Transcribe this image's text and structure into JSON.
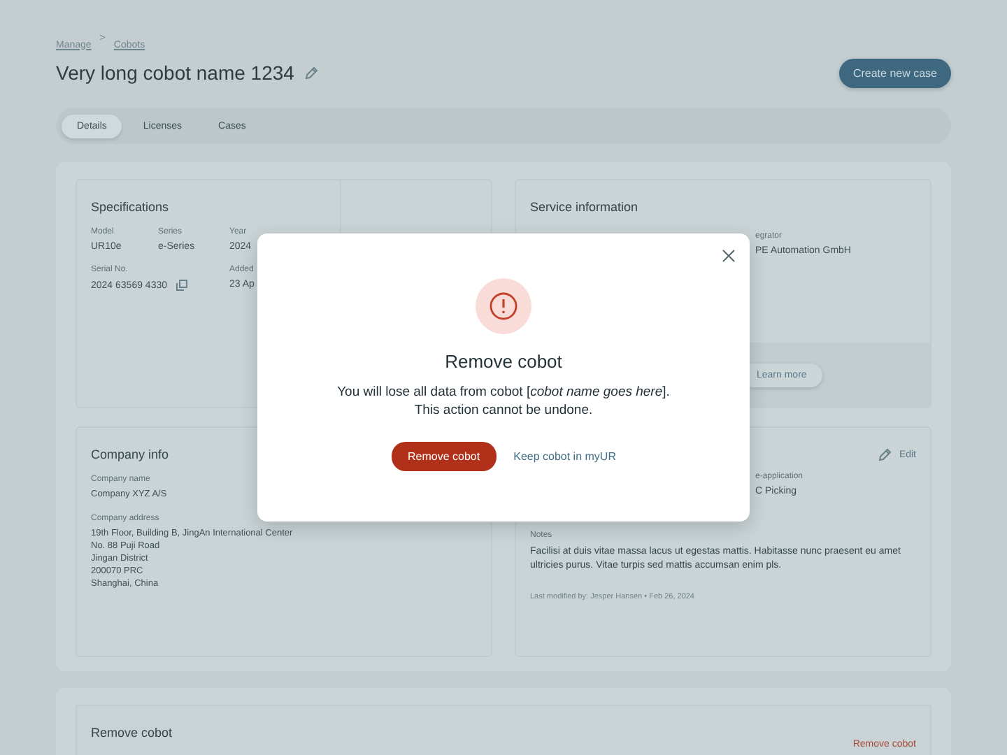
{
  "breadcrumb": {
    "items": [
      "Manage",
      "Cobots"
    ],
    "separator": ">"
  },
  "header": {
    "title": "Very long cobot name 1234",
    "primary_action": "Create new case"
  },
  "tabs": [
    {
      "label": "Details",
      "selected": true
    },
    {
      "label": "Licenses",
      "selected": false
    },
    {
      "label": "Cases",
      "selected": false
    }
  ],
  "specifications": {
    "title": "Specifications",
    "rows": [
      [
        {
          "label": "Model",
          "value": "UR10e",
          "copyable": false
        },
        {
          "label": "Series",
          "value": "e-Series",
          "copyable": false
        },
        {
          "label": "Year",
          "value": "2024",
          "copyable": false
        }
      ],
      [
        {
          "label": "Serial No.",
          "value": "2024 63569 4330",
          "copyable": true
        },
        "",
        {
          "label": "Added",
          "value": "23 Ap",
          "copyable": false
        }
      ]
    ]
  },
  "service": {
    "title": "Service information",
    "fields": [
      {
        "label": "egrator",
        "value": "PE Automation GmbH"
      }
    ],
    "action": "Learn more"
  },
  "company": {
    "title": "Company info",
    "fields": [
      {
        "label": "Company name",
        "lines": [
          "Company XYZ A/S"
        ]
      },
      {
        "label": "Company address",
        "lines": [
          "19th Floor, Building B, JingAn International Center",
          "No. 88 Puji Road",
          "Jingan District",
          "200070 PRC",
          "Shanghai, China"
        ]
      }
    ]
  },
  "application": {
    "edit": "Edit",
    "fields": [
      {
        "label": "e-application",
        "value": "C Picking"
      }
    ],
    "notes_label": "Notes",
    "notes": "Facilisi at duis vitae massa lacus ut egestas mattis. Habitasse nunc praesent eu amet ultricies purus. Vitae turpis sed mattis accumsan enim pls.",
    "modified": "Last modified by: Jesper Hansen • Feb 26, 2024"
  },
  "danger": {
    "title": "Remove cobot",
    "action": "Remove cobot"
  },
  "modal": {
    "title": "Remove cobot",
    "message": "You will lose all data from cobot [*cobot name goes here*].",
    "note": "This action cannot be undone.",
    "confirm": "Remove cobot",
    "cancel": "Keep cobot in myUR"
  }
}
